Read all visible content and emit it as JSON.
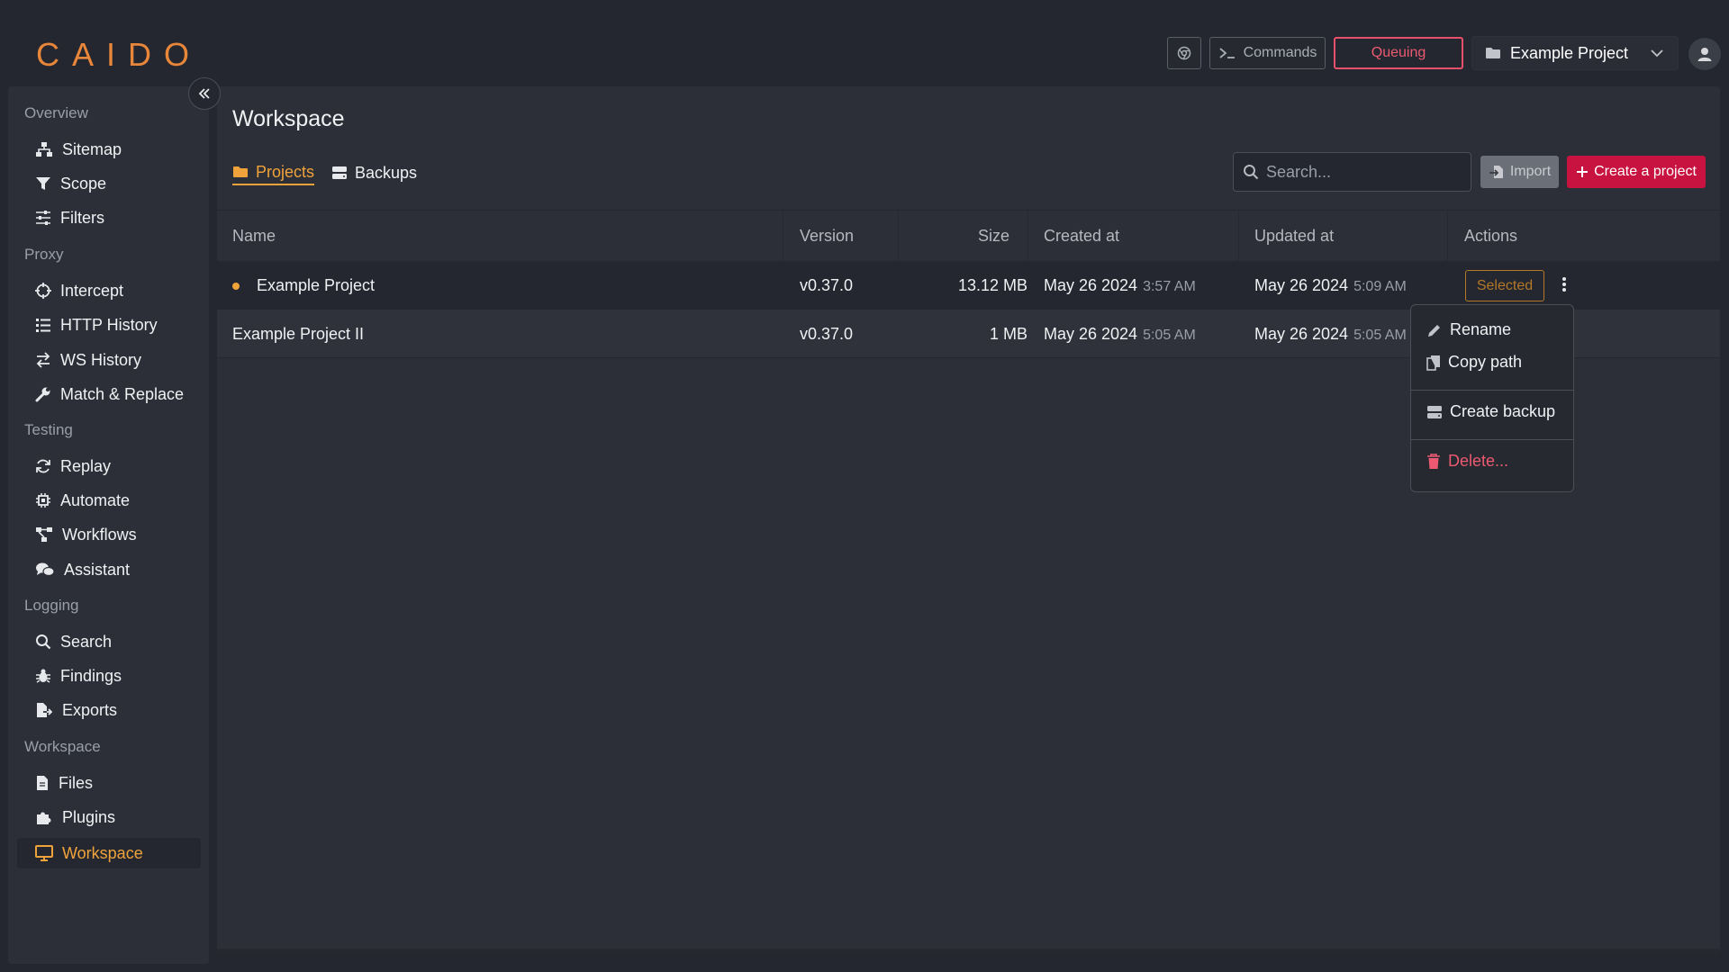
{
  "header": {
    "logo": "CAIDO",
    "commands_label": "Commands",
    "queuing_label": "Queuing",
    "project_name": "Example Project"
  },
  "sidebar": {
    "sections": [
      {
        "title": "Overview",
        "items": [
          {
            "label": "Sitemap"
          },
          {
            "label": "Scope"
          },
          {
            "label": "Filters"
          }
        ]
      },
      {
        "title": "Proxy",
        "items": [
          {
            "label": "Intercept"
          },
          {
            "label": "HTTP History"
          },
          {
            "label": "WS History"
          },
          {
            "label": "Match & Replace"
          }
        ]
      },
      {
        "title": "Testing",
        "items": [
          {
            "label": "Replay"
          },
          {
            "label": "Automate"
          },
          {
            "label": "Workflows"
          },
          {
            "label": "Assistant"
          }
        ]
      },
      {
        "title": "Logging",
        "items": [
          {
            "label": "Search"
          },
          {
            "label": "Findings"
          },
          {
            "label": "Exports"
          }
        ]
      },
      {
        "title": "Workspace",
        "items": [
          {
            "label": "Files"
          },
          {
            "label": "Plugins"
          },
          {
            "label": "Workspace"
          }
        ]
      }
    ]
  },
  "main": {
    "title": "Workspace",
    "tabs": [
      {
        "label": "Projects"
      },
      {
        "label": "Backups"
      }
    ],
    "search_placeholder": "Search...",
    "import_label": "Import",
    "create_label": "Create a project",
    "columns": [
      "Name",
      "Version",
      "Size",
      "Created at",
      "Updated at",
      "Actions"
    ],
    "rows": [
      {
        "name": "Example Project",
        "version": "v0.37.0",
        "size": "13.12 MB",
        "created_date": "May 26 2024",
        "created_time": "3:57 AM",
        "updated_date": "May 26 2024",
        "updated_time": "5:09 AM",
        "status": "Selected"
      },
      {
        "name": "Example Project II",
        "version": "v0.37.0",
        "size": "1 MB",
        "created_date": "May 26 2024",
        "created_time": "5:05 AM",
        "updated_date": "May 26 2024",
        "updated_time": "5:05 AM"
      }
    ]
  },
  "context_menu": {
    "rename": "Rename",
    "copy_path": "Copy path",
    "create_backup": "Create backup",
    "delete": "Delete..."
  },
  "colors": {
    "accent": "#f0a33a",
    "danger": "#c8123f",
    "background": "#24272f",
    "panel": "#2c2f37"
  }
}
